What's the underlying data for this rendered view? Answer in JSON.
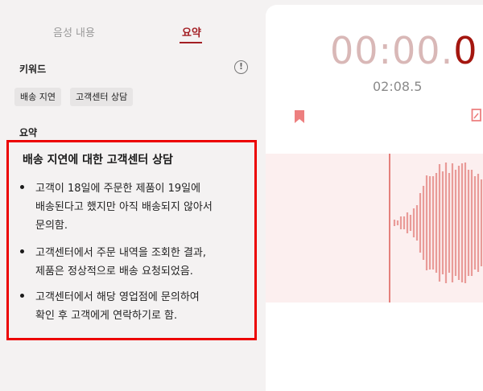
{
  "tabs": {
    "voice_content": "음성 내용",
    "summary": "요약"
  },
  "keywords": {
    "label": "키워드",
    "items": [
      "배송 지연",
      "고객센터 상담"
    ]
  },
  "summary": {
    "label": "요약",
    "heading": "배송 지연에 대한 고객센터 상담",
    "bullets": [
      {
        "lines": [
          "고객이 18일에 주문한 제품이 19일에",
          "배송된다고 했지만 아직 배송되지 않아서",
          "문의함."
        ]
      },
      {
        "lines": [
          "고객센터에서 주문 내역을 조회한 결과,",
          "제품은 정상적으로 배송 요청되었음."
        ]
      },
      {
        "lines": [
          "고객센터에서 해당 영업점에 문의하여",
          "확인 후 고객에게 연락하기로 함."
        ]
      }
    ]
  },
  "player": {
    "timer_faded": "00:00.",
    "timer_active": "0",
    "total_time": "02:08.5"
  },
  "icons": {
    "info": "info-icon",
    "bookmark": "bookmark-icon",
    "partial": "partial-icon"
  },
  "colors": {
    "accent": "#a31f24",
    "highlight_border": "#ec0000",
    "timer_faded": "#d9b8b7",
    "timer_active": "#a4160f",
    "waveform": "#e99b98",
    "waveform_bg": "#fcefef",
    "playhead": "#e4807c",
    "bookmark": "#ed7f7f"
  }
}
